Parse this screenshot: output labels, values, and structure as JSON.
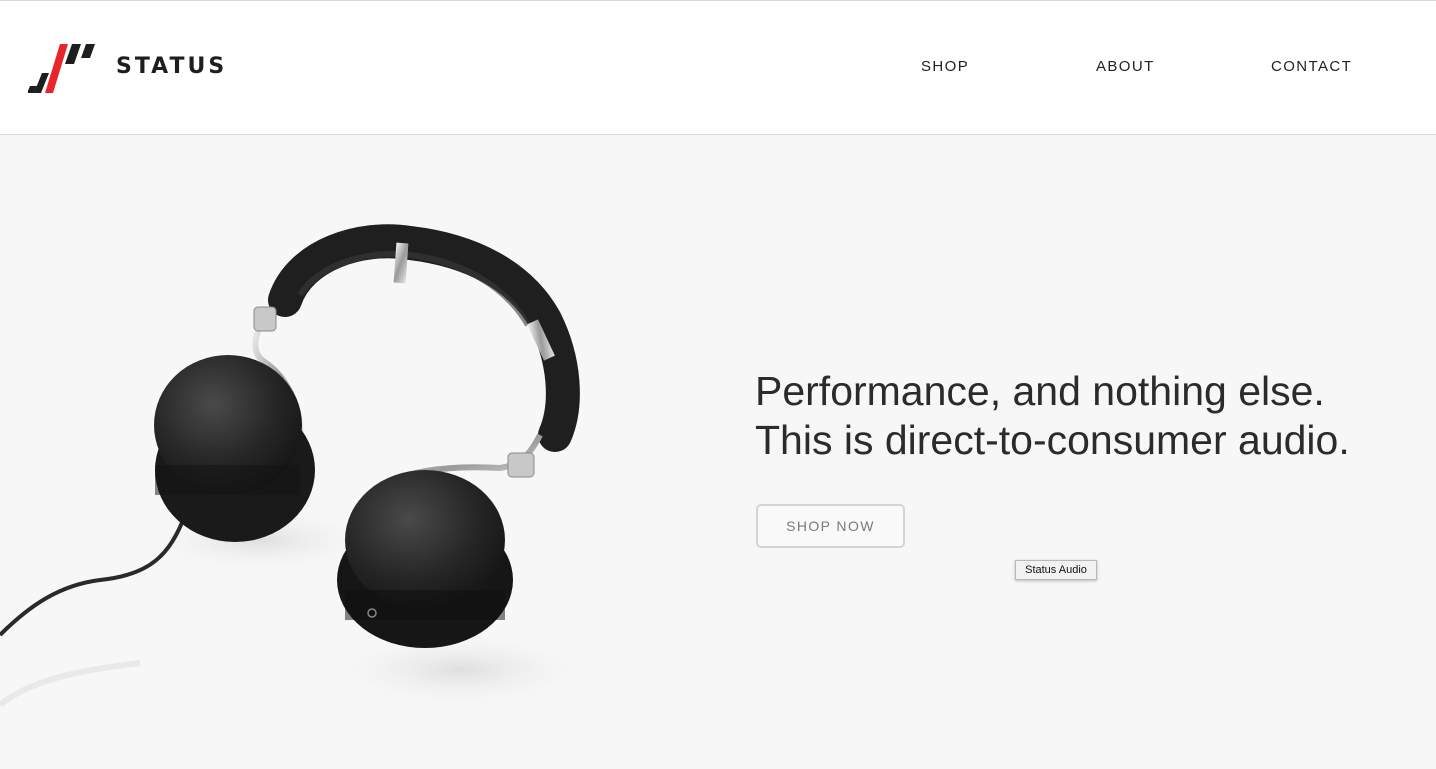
{
  "brand": {
    "name": "STATUS",
    "accent": "#e8262a",
    "dark": "#1e1e1e"
  },
  "nav": {
    "shop": "SHOP",
    "about": "ABOUT",
    "contact": "CONTACT"
  },
  "hero": {
    "headline_line1": "Performance, and nothing else.",
    "headline_line2": "This is direct-to-consumer audio.",
    "cta": "SHOP NOW",
    "tooltip": "Status Audio",
    "image_icon": "headphones-image"
  }
}
